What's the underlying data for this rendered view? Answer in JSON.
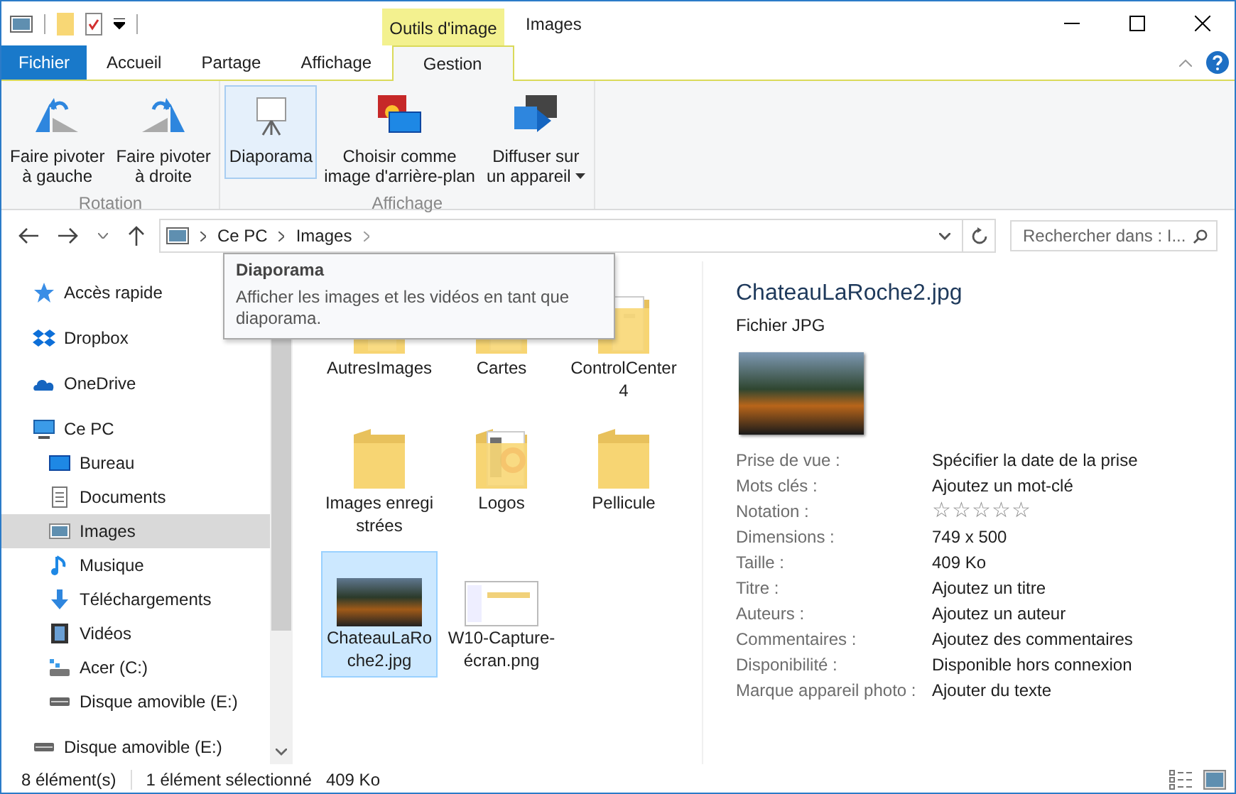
{
  "window": {
    "title": "Images",
    "context_tab": "Outils d'image"
  },
  "tabs": [
    {
      "label": "Fichier",
      "kind": "file",
      "selected": false
    },
    {
      "label": "Accueil",
      "kind": "tab",
      "selected": false
    },
    {
      "label": "Partage",
      "kind": "tab",
      "selected": false
    },
    {
      "label": "Affichage",
      "kind": "tab",
      "selected": false
    },
    {
      "label": "Gestion",
      "kind": "context",
      "selected": true
    }
  ],
  "ribbon": {
    "groups": [
      {
        "label": "Rotation",
        "buttons": [
          {
            "label": "Faire pivoter\nà gauche",
            "kind": "rotate-left",
            "highlighted": false,
            "dropdown": false
          },
          {
            "label": "Faire pivoter\nà droite",
            "kind": "rotate-right",
            "highlighted": false,
            "dropdown": false
          }
        ]
      },
      {
        "label": "Affichage",
        "buttons": [
          {
            "label": "Diaporama",
            "kind": "slideshow",
            "highlighted": true,
            "dropdown": false
          },
          {
            "label": "Choisir comme\nimage d'arrière-plan",
            "kind": "wallpaper",
            "highlighted": false,
            "dropdown": false
          },
          {
            "label": "Diffuser sur\nun appareil",
            "kind": "cast",
            "highlighted": false,
            "dropdown": true
          }
        ]
      }
    ]
  },
  "tooltip": {
    "title": "Diaporama",
    "text": "Afficher les images et les vidéos en tant que diaporama."
  },
  "address_bar": {
    "crumbs": [
      "Ce PC",
      "Images"
    ],
    "search": {
      "placeholder": "Rechercher dans : I..."
    }
  },
  "sidebar": {
    "items": [
      {
        "label": "Accès rapide",
        "kind": "star",
        "selected": false
      },
      {
        "label": "Dropbox",
        "kind": "dropbox",
        "selected": false
      },
      {
        "label": "OneDrive",
        "kind": "cloud",
        "selected": false
      },
      {
        "label": "Ce PC",
        "kind": "pc",
        "selected": false,
        "children": [
          {
            "label": "Bureau",
            "kind": "desktop",
            "selected": false
          },
          {
            "label": "Documents",
            "kind": "document",
            "selected": false
          },
          {
            "label": "Images",
            "kind": "picture",
            "selected": true
          },
          {
            "label": "Musique",
            "kind": "music",
            "selected": false
          },
          {
            "label": "Téléchargements",
            "kind": "download",
            "selected": false
          },
          {
            "label": "Vidéos",
            "kind": "video",
            "selected": false
          },
          {
            "label": "Acer (C:)",
            "kind": "drive",
            "selected": false
          },
          {
            "label": "Disque amovible (E:)",
            "kind": "usb",
            "selected": false
          }
        ]
      },
      {
        "label": "Disque amovible (E:)",
        "kind": "usb",
        "selected": false
      }
    ]
  },
  "files": [
    {
      "name": "AutresImages",
      "kind": "folder-colorful",
      "selected": false
    },
    {
      "name": "Cartes",
      "kind": "folder-pages",
      "selected": false
    },
    {
      "name": "ControlCenter4",
      "kind": "folder-pages",
      "selected": false
    },
    {
      "name": "Images enregistrées",
      "kind": "folder",
      "selected": false
    },
    {
      "name": "Logos",
      "kind": "folder-logo",
      "selected": false
    },
    {
      "name": "Pellicule",
      "kind": "folder",
      "selected": false
    },
    {
      "name": "ChateauLaRoche2.jpg",
      "kind": "photo",
      "selected": true
    },
    {
      "name": "W10-Capture-écran.png",
      "kind": "screenshot",
      "selected": false
    }
  ],
  "details": {
    "title": "ChateauLaRoche2.jpg",
    "type": "Fichier JPG",
    "properties": [
      {
        "label": "Prise de vue :",
        "kind": "text",
        "value": "Spécifier la date de la prise"
      },
      {
        "label": "Mots clés :",
        "kind": "text",
        "value": "Ajoutez un mot-clé"
      },
      {
        "label": "Notation :",
        "kind": "rating",
        "stars": 0
      },
      {
        "label": "Dimensions :",
        "kind": "text",
        "value": "749 x 500"
      },
      {
        "label": "Taille :",
        "kind": "text",
        "value": "409 Ko"
      },
      {
        "label": "Titre :",
        "kind": "text",
        "value": "Ajoutez un titre"
      },
      {
        "label": "Auteurs :",
        "kind": "text",
        "value": "Ajoutez un auteur"
      },
      {
        "label": "Commentaires :",
        "kind": "text",
        "value": "Ajoutez des commentaires"
      },
      {
        "label": "Disponibilité :",
        "kind": "text",
        "value": "Disponible hors connexion"
      },
      {
        "label": "Marque appareil photo :",
        "kind": "text",
        "value": "Ajouter du texte"
      }
    ]
  },
  "status_bar": {
    "count": "8 élément(s)",
    "selection": "1 élément sélectionné",
    "size": "409 Ko"
  }
}
